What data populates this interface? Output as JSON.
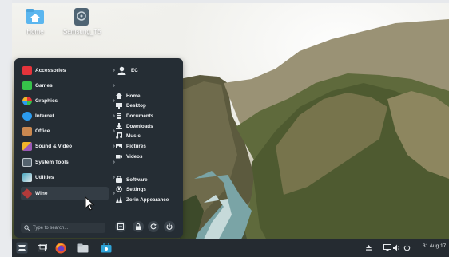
{
  "desktop": {
    "icons": [
      {
        "label": "Home"
      },
      {
        "label": "Samsung_T5"
      }
    ]
  },
  "menu": {
    "categories": [
      {
        "label": "Accessories",
        "color": "#e4343b"
      },
      {
        "label": "Games",
        "color": "#36c24a"
      },
      {
        "label": "Graphics",
        "color": "#f3f3f3"
      },
      {
        "label": "Internet",
        "color": "#2b9cf0"
      },
      {
        "label": "Office",
        "color": "#c98850"
      },
      {
        "label": "Sound & Video",
        "color": "#f0b529"
      },
      {
        "label": "System Tools",
        "color": "#55636e"
      },
      {
        "label": "Utilities",
        "color": "#4aa8c0"
      },
      {
        "label": "Wine",
        "color": "#b33a3a"
      }
    ],
    "user": {
      "name": "EC"
    },
    "places": [
      {
        "label": "Home",
        "icon": "home-icon"
      },
      {
        "label": "Desktop",
        "icon": "desktop-icon"
      },
      {
        "label": "Documents",
        "icon": "documents-icon"
      },
      {
        "label": "Downloads",
        "icon": "downloads-icon"
      },
      {
        "label": "Music",
        "icon": "music-icon"
      },
      {
        "label": "Pictures",
        "icon": "pictures-icon"
      },
      {
        "label": "Videos",
        "icon": "videos-icon"
      }
    ],
    "system": [
      {
        "label": "Software",
        "icon": "software-icon"
      },
      {
        "label": "Settings",
        "icon": "settings-icon"
      },
      {
        "label": "Zorin Appearance",
        "icon": "appearance-icon"
      }
    ],
    "search_placeholder": "Type to search...",
    "power_buttons": [
      "logout-icon",
      "lock-icon",
      "restart-icon",
      "power-icon"
    ]
  },
  "taskbar": {
    "clock": "31 Aug 17"
  }
}
